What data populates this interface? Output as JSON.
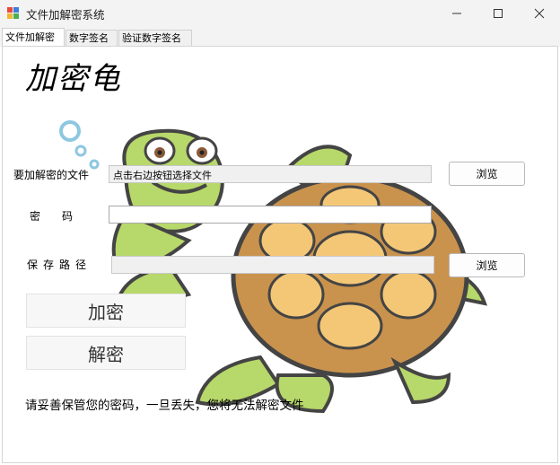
{
  "window": {
    "title": "文件加解密系统"
  },
  "tabs": [
    {
      "label": "文件加解密",
      "active": true
    },
    {
      "label": "数字签名",
      "active": false
    },
    {
      "label": "验证数字签名",
      "active": false
    }
  ],
  "main": {
    "brand": "加密龟",
    "file_label": "要加解密的文件",
    "file_value": "点击右边按钮选择文件",
    "browse_label": "浏览",
    "password_label": "密　　码",
    "password_value": "",
    "save_label": "保存路径",
    "save_value": "",
    "browse2_label": "浏览",
    "encrypt_label": "加密",
    "decrypt_label": "解密",
    "warning": "请妥善保管您的密码，一旦丢失，您将无法解密文件"
  },
  "colors": {
    "turtle_shell": "#c9934e",
    "turtle_shell_plate": "#f4c777",
    "turtle_skin": "#b7d86a",
    "bubble": "#8ec7e0"
  }
}
